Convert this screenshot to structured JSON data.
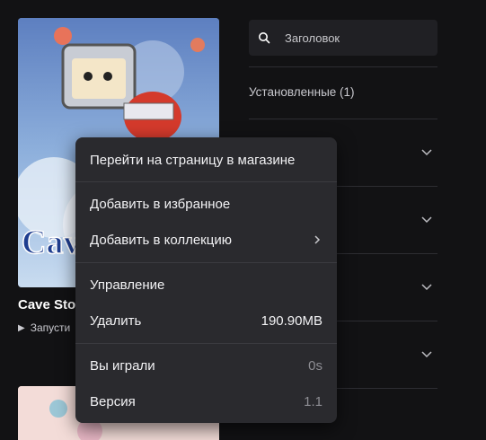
{
  "library": {
    "game_title": "Cave Sto",
    "launch_label": "Запусти",
    "cover_text": "Cave"
  },
  "search": {
    "placeholder": "Заголовок"
  },
  "filters": {
    "installed_label": "Установленные (1)"
  },
  "context_menu": {
    "items": [
      {
        "label": "Перейти на страницу в магазине"
      },
      {
        "label": "Добавить в избранное"
      },
      {
        "label": "Добавить в коллекцию"
      },
      {
        "label": "Управление"
      },
      {
        "label": "Удалить",
        "value": "190.90MB"
      },
      {
        "label": "Вы играли",
        "value": "0s"
      },
      {
        "label": "Версия",
        "value": "1.1"
      }
    ]
  },
  "colors": {
    "background": "#121214",
    "menu": "#2a2a2e",
    "search_bg": "#202024"
  }
}
